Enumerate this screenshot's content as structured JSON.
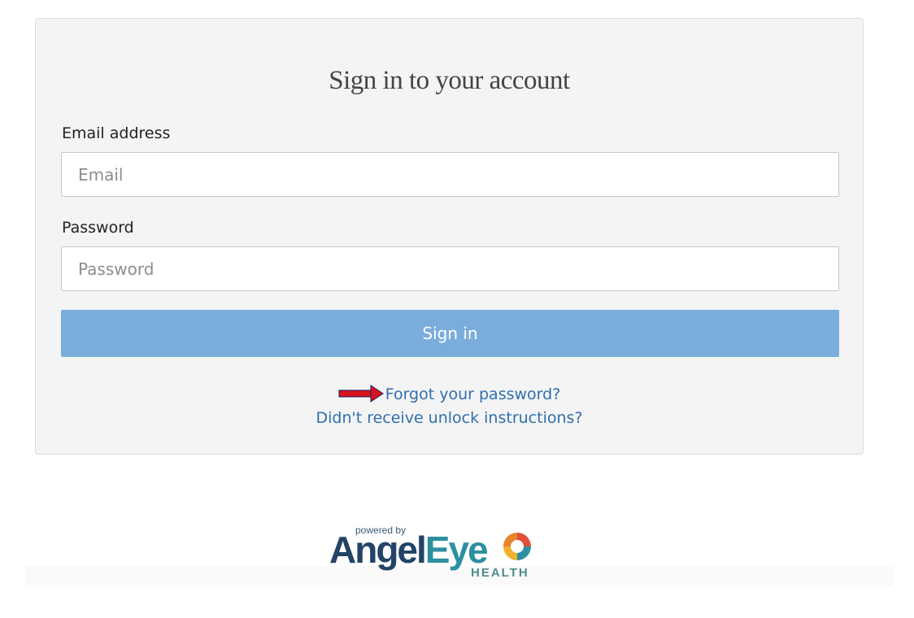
{
  "form": {
    "title": "Sign in to your account",
    "email_label": "Email address",
    "email_placeholder": "Email",
    "password_label": "Password",
    "password_placeholder": "Password",
    "submit_label": "Sign in"
  },
  "links": {
    "forgot_password": "Forgot your password?",
    "unlock_instructions": "Didn't receive unlock instructions?"
  },
  "footer": {
    "powered_by": "powered by",
    "brand_part1": "Angel",
    "brand_part2": "Eye",
    "brand_sub": "HEALTH"
  },
  "colors": {
    "card_bg": "#f4f4f4",
    "button_bg": "#7aaddc",
    "link": "#2e6fae",
    "arrow": "#d8141c"
  },
  "icons": {
    "annotation": "red-arrow-icon",
    "logo_mark": "eye-logo-icon"
  }
}
